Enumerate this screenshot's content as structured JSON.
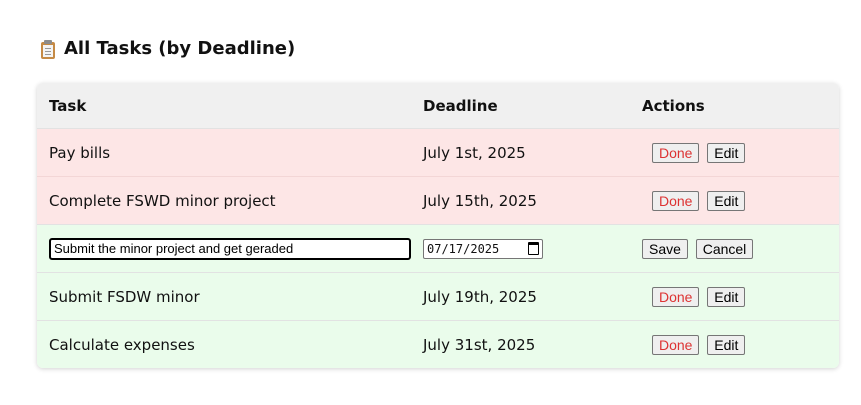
{
  "heading": {
    "title": "All Tasks (by Deadline)",
    "icon": "clipboard-icon"
  },
  "table": {
    "columns": [
      "Task",
      "Deadline",
      "Actions"
    ],
    "rows": [
      {
        "task": "Pay bills",
        "deadline": "July 1st, 2025",
        "status": "overdue"
      },
      {
        "task": "Complete FSWD minor project",
        "deadline": "July 15th, 2025",
        "status": "overdue"
      },
      {
        "task": "Submit the minor project and get geraded",
        "deadline": "07/17/2025",
        "status": "editing"
      },
      {
        "task": "Submit FSDW minor",
        "deadline": "July 19th, 2025",
        "status": "upcoming"
      },
      {
        "task": "Calculate expenses",
        "deadline": "July 31st, 2025",
        "status": "upcoming"
      }
    ]
  },
  "buttons": {
    "done": "Done",
    "edit": "Edit",
    "save": "Save",
    "cancel": "Cancel"
  },
  "colors": {
    "overdue_row": "#fde6e6",
    "upcoming_row": "#eafceb",
    "header_bg": "#f0f0f0",
    "done_text": "#dd3333"
  }
}
